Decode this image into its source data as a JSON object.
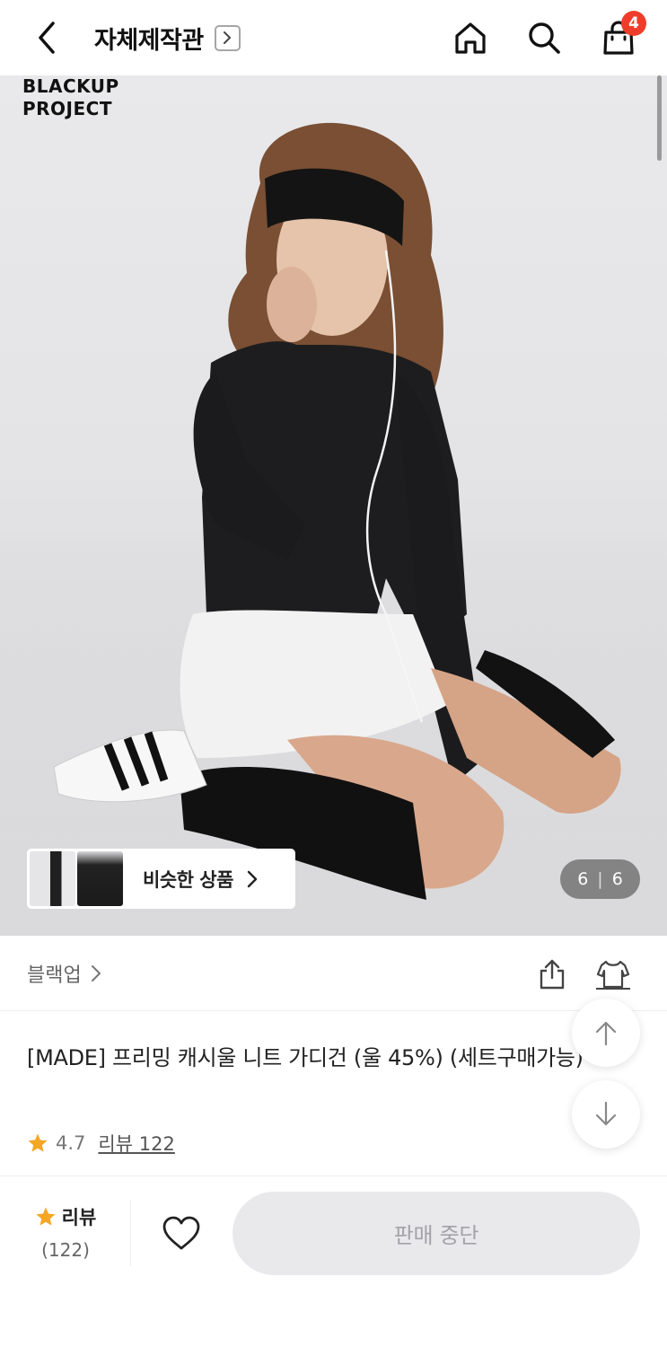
{
  "header": {
    "title": "자체제작관",
    "cart_count": "4",
    "icons": [
      "back-arrow-icon",
      "chevron-right-icon",
      "home-icon",
      "search-icon",
      "shopping-bag-icon"
    ]
  },
  "hero": {
    "brand_logo_line1": "BLACKUP",
    "brand_logo_line2": "PROJECT",
    "similar_label": "비슷한 상품",
    "counter_current": "6",
    "counter_sep": "|",
    "counter_total": "6"
  },
  "brand_row": {
    "brand_name": "블랙업",
    "icons": [
      "share-icon",
      "fitting-icon"
    ]
  },
  "product": {
    "title": "[MADE] 프리밍 캐시울 니트 가디건 (울 45%) (세트구매가능)",
    "rating": "4.7",
    "review_link": "리뷰 122"
  },
  "bottom_bar": {
    "review_label": "리뷰",
    "review_count": "(122)",
    "buy_label": "판매 중단"
  },
  "colors": {
    "accent_star": "#f5a623",
    "badge_red": "#ee3e2b",
    "disabled_button": "#e9e9ec"
  }
}
